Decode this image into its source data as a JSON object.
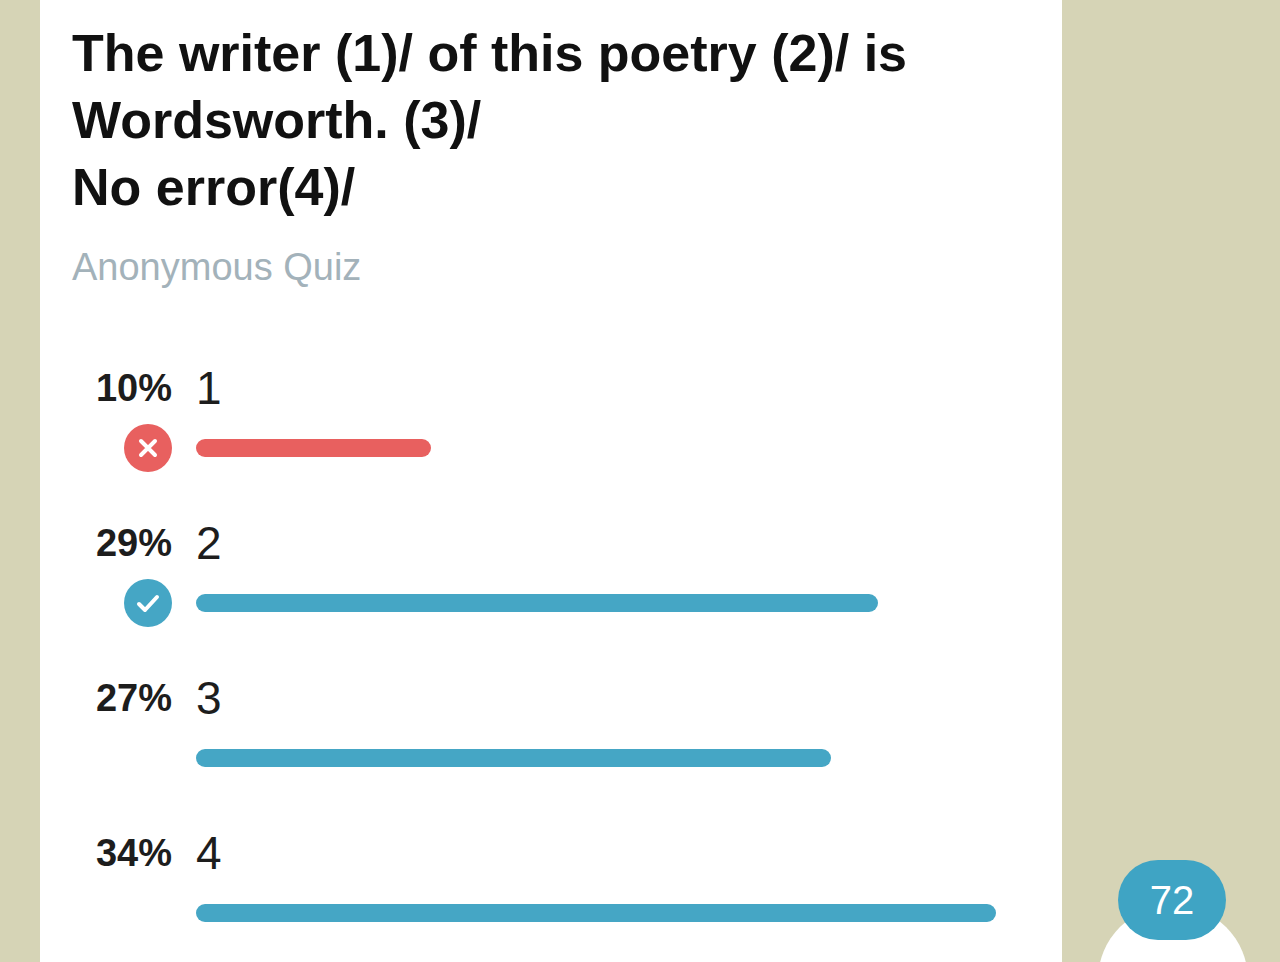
{
  "question": {
    "lines": [
      "The writer (1)/ of this poetry (2)/ is",
      "Wordsworth. (3)/",
      "No error(4)/"
    ]
  },
  "quiz_type": "Anonymous Quiz",
  "options": [
    {
      "percent": "10%",
      "label": "1",
      "level": 0.1,
      "chosen": true,
      "correct": false,
      "color": "#e8605f"
    },
    {
      "percent": "29%",
      "label": "2",
      "level": 0.29,
      "chosen": false,
      "correct": true,
      "color": "#45a6c5"
    },
    {
      "percent": "27%",
      "label": "3",
      "level": 0.27,
      "chosen": false,
      "correct": false,
      "color": "#45a6c5"
    },
    {
      "percent": "34%",
      "label": "4",
      "level": 0.34,
      "chosen": false,
      "correct": false,
      "color": "#45a6c5"
    }
  ],
  "unread_badge": "72"
}
